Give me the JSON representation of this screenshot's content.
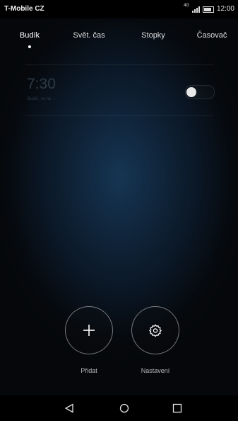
{
  "status_bar": {
    "carrier": "T-Mobile CZ",
    "time": "12:00",
    "network_badge": "4G"
  },
  "tabs": [
    {
      "label": "Budík",
      "active": true
    },
    {
      "label": "Svět. čas",
      "active": false
    },
    {
      "label": "Stopky",
      "active": false
    },
    {
      "label": "Časovač",
      "active": false
    }
  ],
  "alarm": {
    "time": "7:30",
    "label": "Budík, so ne",
    "enabled": false
  },
  "actions": {
    "add_label": "Přidat",
    "add_icon": "plus-icon",
    "settings_label": "Nastavení",
    "settings_icon": "gear-icon"
  },
  "nav": {
    "back_icon": "back-triangle-icon",
    "home_icon": "home-circle-icon",
    "recents_icon": "recents-square-icon"
  }
}
